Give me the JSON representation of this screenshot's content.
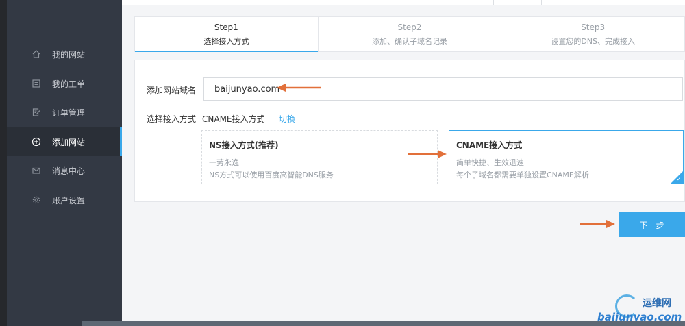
{
  "sidebar": {
    "items": [
      {
        "label": "我的网站",
        "icon": "home-icon",
        "active": false
      },
      {
        "label": "我的工单",
        "icon": "ticket-icon",
        "active": false
      },
      {
        "label": "订单管理",
        "icon": "order-icon",
        "active": false
      },
      {
        "label": "添加网站",
        "icon": "plus-circle-icon",
        "active": true
      },
      {
        "label": "消息中心",
        "icon": "mail-icon",
        "active": false
      },
      {
        "label": "账户设置",
        "icon": "gear-icon",
        "active": false
      }
    ]
  },
  "steps": [
    {
      "title": "Step1",
      "subtitle": "选择接入方式",
      "active": true
    },
    {
      "title": "Step2",
      "subtitle": "添加、确认子域名记录",
      "active": false
    },
    {
      "title": "Step3",
      "subtitle": "设置您的DNS、完成接入",
      "active": false
    }
  ],
  "form": {
    "domain_label": "添加网站域名",
    "domain_value": "baijunyao.com",
    "method_label": "选择接入方式",
    "method_value": "CNAME接入方式",
    "switch_label": "切换"
  },
  "options": [
    {
      "title": "NS接入方式(推荐)",
      "line1": "一劳永逸",
      "line2": "NS方式可以使用百度高智能DNS服务",
      "selected": false
    },
    {
      "title": "CNAME接入方式",
      "line1": "简单快捷、生效迅速",
      "line2": "每个子域名都需要单独设置CNAME解析",
      "selected": true
    }
  ],
  "next_button": "下一步",
  "watermark": {
    "cn": "运维网",
    "en": "baijunyao.com"
  },
  "colors": {
    "accent": "#3aa8ea",
    "sidebar_bg": "#333944",
    "annotation_arrow": "#e2703a"
  }
}
